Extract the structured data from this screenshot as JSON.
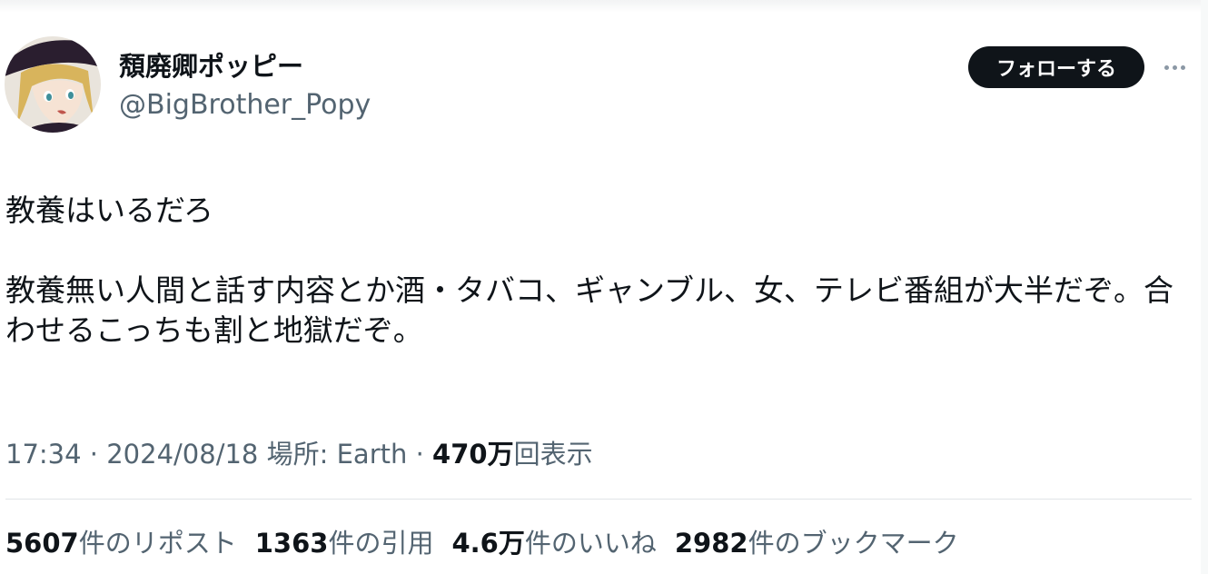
{
  "profile": {
    "display_name": "頽廃卿ポッピー",
    "handle": "@BigBrother_Popy"
  },
  "actions": {
    "follow_label": "フォローする",
    "more_icon": "more-horizontal-icon"
  },
  "tweet": {
    "line1": "教養はいるだろ",
    "line2": "教養無い人間と話す内容とか酒・タバコ、ギャンブル、女、テレビ番組が大半だぞ。合わせるこっちも割と地獄だぞ。"
  },
  "meta": {
    "time": "17:34",
    "sep1": " · ",
    "date": "2024/08/18",
    "location": " 場所: Earth",
    "sep2": " · ",
    "views_number": "470万",
    "views_label": "回表示"
  },
  "stats": {
    "reposts": {
      "number": "5607",
      "label": "件のリポスト"
    },
    "quotes": {
      "number": "1363",
      "label": "件の引用"
    },
    "likes": {
      "number": "4.6万",
      "label": "件のいいね"
    },
    "bookmarks": {
      "number": "2982",
      "label": "件のブックマーク"
    }
  },
  "colors": {
    "text_primary": "#0f1419",
    "text_secondary": "#536471",
    "button_bg": "#0f1419",
    "divider": "#e1e5e8"
  }
}
